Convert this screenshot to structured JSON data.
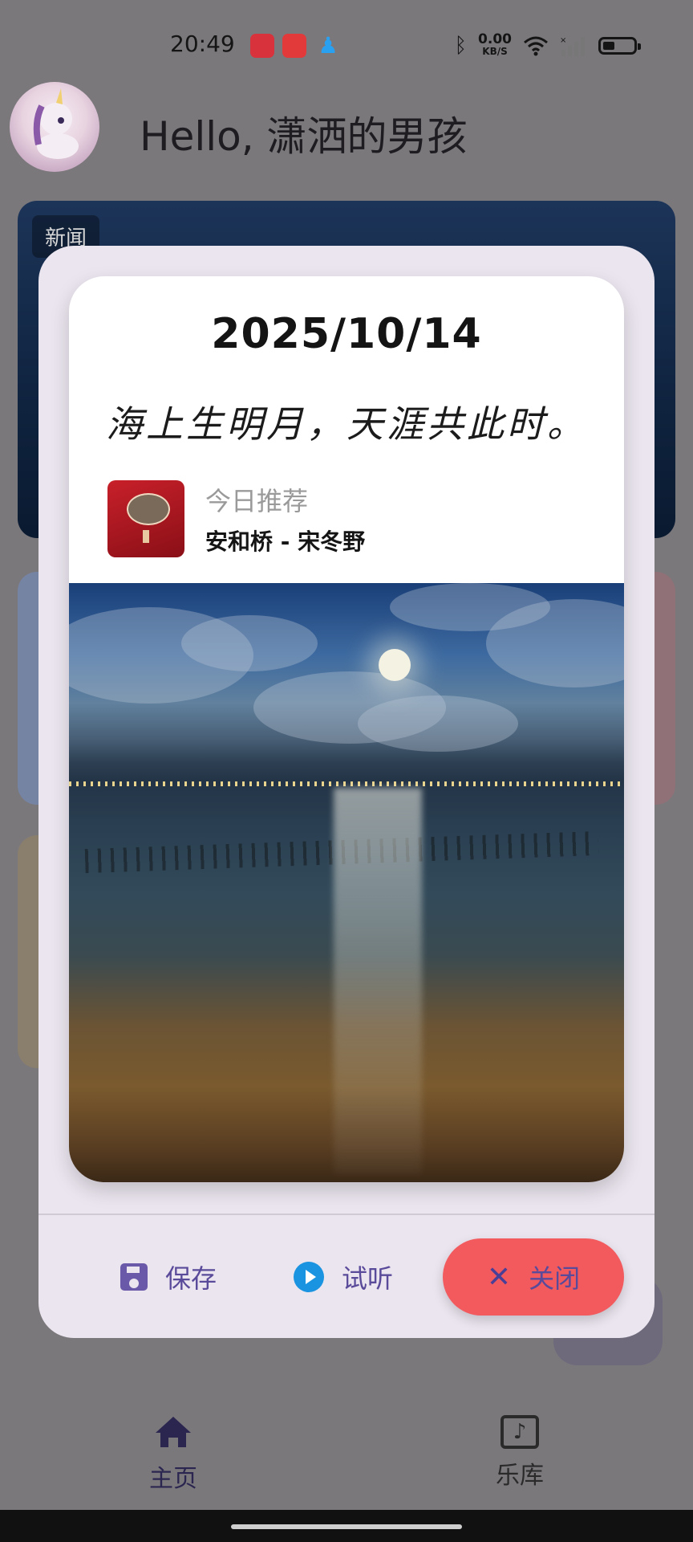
{
  "status_bar": {
    "time": "20:49",
    "net_speed_value": "0.00",
    "net_speed_unit": "KB/S",
    "icons": [
      "app-notification-icon",
      "app-notification-icon",
      "qq-icon",
      "bluetooth-icon",
      "wifi-icon",
      "signal-icon",
      "battery-icon"
    ]
  },
  "header": {
    "greeting": "Hello, 潇洒的男孩"
  },
  "news": {
    "tag": "新闻"
  },
  "dialog": {
    "date": "2025/10/14",
    "quote": "海上生明月，天涯共此时。",
    "song_kicker": "今日推荐",
    "song_title": "安和桥 - 宋冬野",
    "actions": {
      "save": "保存",
      "listen": "试听",
      "close": "关闭"
    },
    "colors": {
      "close_button": "#f25a5e",
      "action_text": "#5a4a9a",
      "play_icon": "#1a94e0"
    }
  },
  "bottom_nav": {
    "home": "主页",
    "library": "乐库"
  }
}
